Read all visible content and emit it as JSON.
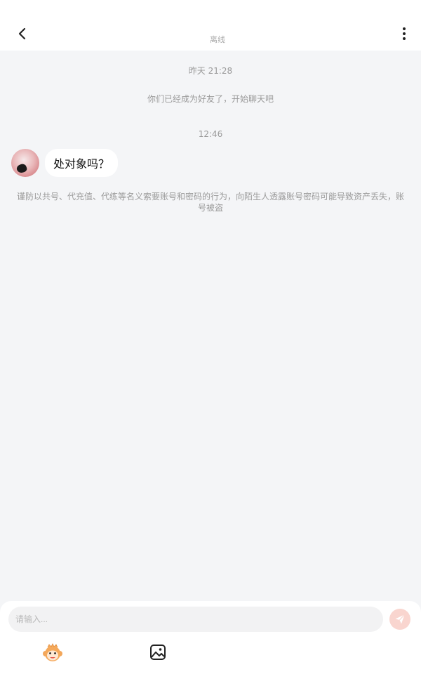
{
  "header": {
    "status": "离线",
    "back_icon": "chevron-left-icon",
    "more_icon": "more-vertical-icon"
  },
  "chat": {
    "time1": "昨天 21:28",
    "friend_notice": "你们已经成为好友了，开始聊天吧",
    "time2": "12:46",
    "messages": [
      {
        "text": "处对象吗？"
      }
    ],
    "safety_warning": "谨防以共号、代充值、代练等名义索要账号和密码的行为，向陌生人透露账号密码可能导致资产丢失，账号被盗"
  },
  "input": {
    "placeholder": "请输入...",
    "send_icon": "send-icon",
    "send_color": "#f9d5cf"
  },
  "toolbar": {
    "sticker_icon": "monkey-sticker-icon",
    "image_icon": "image-icon"
  }
}
